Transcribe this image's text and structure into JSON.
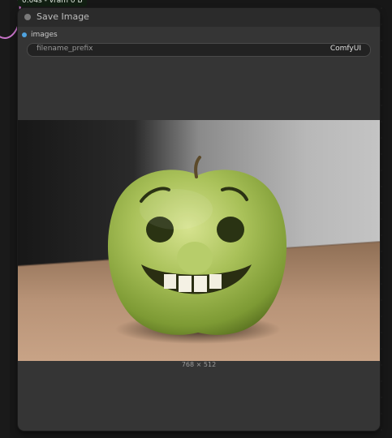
{
  "canvas": {
    "vram_badge": "0.04s - vram 0 B"
  },
  "node": {
    "title": "Save Image",
    "input": {
      "label": "images"
    },
    "widget": {
      "name": "filename_prefix",
      "value": "ComfyUI"
    },
    "preview": {
      "caption": "768 × 512",
      "image_desc": "smiling-green-apple"
    }
  },
  "colors": {
    "node_bg": "#353535",
    "header_bg": "#2b2b2b",
    "input_dot": "#4fa3e0",
    "link_pink": "#c873c9"
  }
}
